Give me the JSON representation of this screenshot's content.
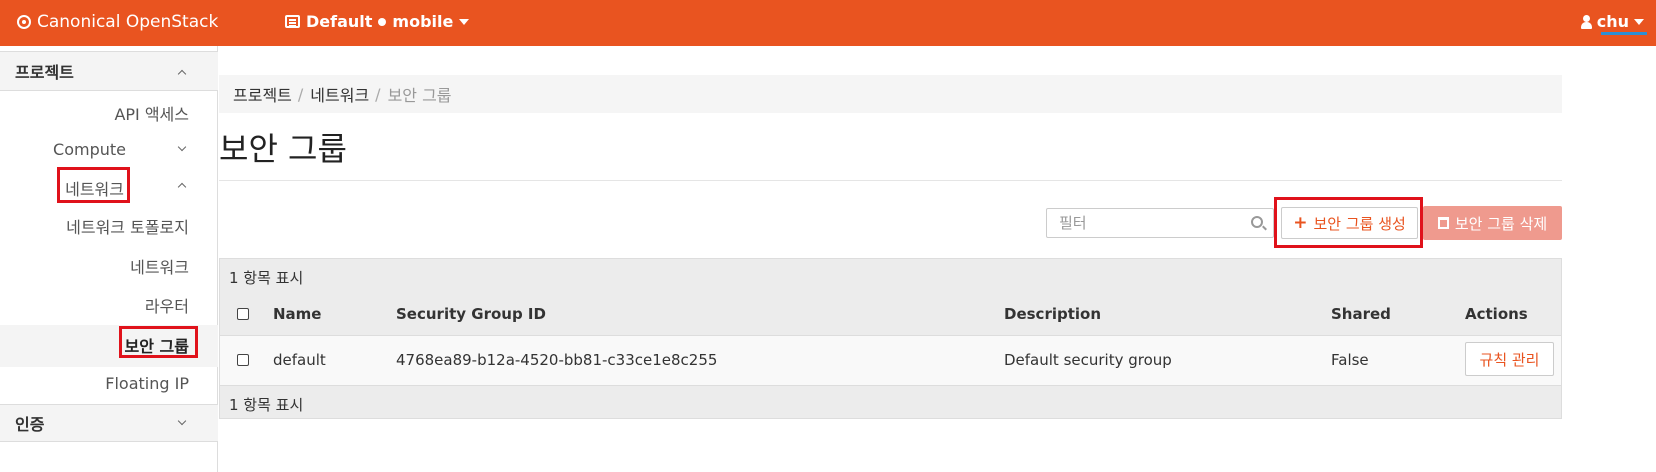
{
  "topbar": {
    "brand": "Canonical OpenStack",
    "domain": "Default",
    "project": "mobile",
    "user": "chu",
    "accent_color": "#e95420"
  },
  "sidebar": {
    "project_section": "프로젝트",
    "items": {
      "api_access": "API 액세스",
      "compute": "Compute",
      "network_group": "네트워크",
      "network_topology": "네트워크 토폴로지",
      "networks": "네트워크",
      "routers": "라우터",
      "security_groups": "보안 그룹",
      "floating_ip": "Floating IP"
    },
    "identity_section": "인증"
  },
  "breadcrumb": {
    "items": [
      "프로젝트",
      "네트워크",
      "보안 그룹"
    ],
    "separator": "/"
  },
  "page": {
    "title": "보안 그룹"
  },
  "toolbar": {
    "filter_placeholder": "필터",
    "create_label": "보안 그룹 생성",
    "delete_label": "보안 그룹 삭제"
  },
  "table": {
    "count_top": "1 항목 표시",
    "count_bottom": "1 항목 표시",
    "columns": {
      "name": "Name",
      "id": "Security Group ID",
      "description": "Description",
      "shared": "Shared",
      "actions": "Actions"
    },
    "rows": [
      {
        "name": "default",
        "id": "4768ea89-b12a-4520-bb81-c33ce1e8c255",
        "description": "Default security group",
        "shared": "False",
        "action": "규칙 관리"
      }
    ]
  }
}
